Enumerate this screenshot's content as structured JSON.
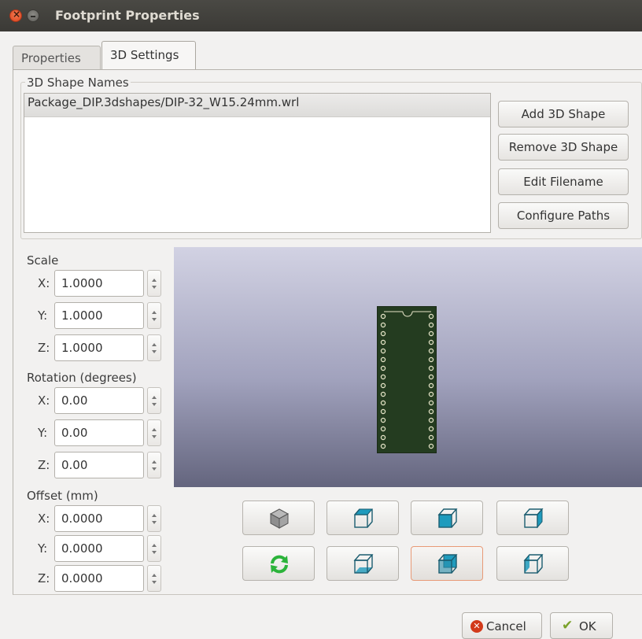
{
  "window": {
    "title": "Footprint Properties"
  },
  "tabs": [
    {
      "label": "Properties",
      "active": false
    },
    {
      "label": "3D Settings",
      "active": true
    }
  ],
  "shapes": {
    "group_title": "3D Shape Names",
    "items": [
      "Package_DIP.3dshapes/DIP-32_W15.24mm.wrl"
    ],
    "buttons": {
      "add": "Add 3D Shape",
      "remove": "Remove 3D Shape",
      "edit": "Edit Filename",
      "configure": "Configure Paths"
    }
  },
  "scale": {
    "label": "Scale",
    "x_label": "X:",
    "y_label": "Y:",
    "z_label": "Z:",
    "x": "1.0000",
    "y": "1.0000",
    "z": "1.0000"
  },
  "rotation": {
    "label": "Rotation (degrees)",
    "x_label": "X:",
    "y_label": "Y:",
    "z_label": "Z:",
    "x": "0.00",
    "y": "0.00",
    "z": "0.00"
  },
  "offset": {
    "label": "Offset (mm)",
    "x_label": "X:",
    "y_label": "Y:",
    "z_label": "Z:",
    "x": "0.0000",
    "y": "0.0000",
    "z": "0.0000"
  },
  "view_buttons": {
    "row1": [
      "view-3d-icon",
      "view-top-icon",
      "view-front-icon",
      "view-right-icon"
    ],
    "row2": [
      "reload-icon",
      "view-bottom-icon",
      "view-back-icon",
      "view-left-icon"
    ],
    "active": "view-back-icon"
  },
  "dialog_buttons": {
    "cancel": "Cancel",
    "ok": "OK"
  },
  "colors": {
    "accent_active_border": "#e89a77",
    "pcb": "#243c20",
    "cube_face": "#1f9bbd"
  }
}
